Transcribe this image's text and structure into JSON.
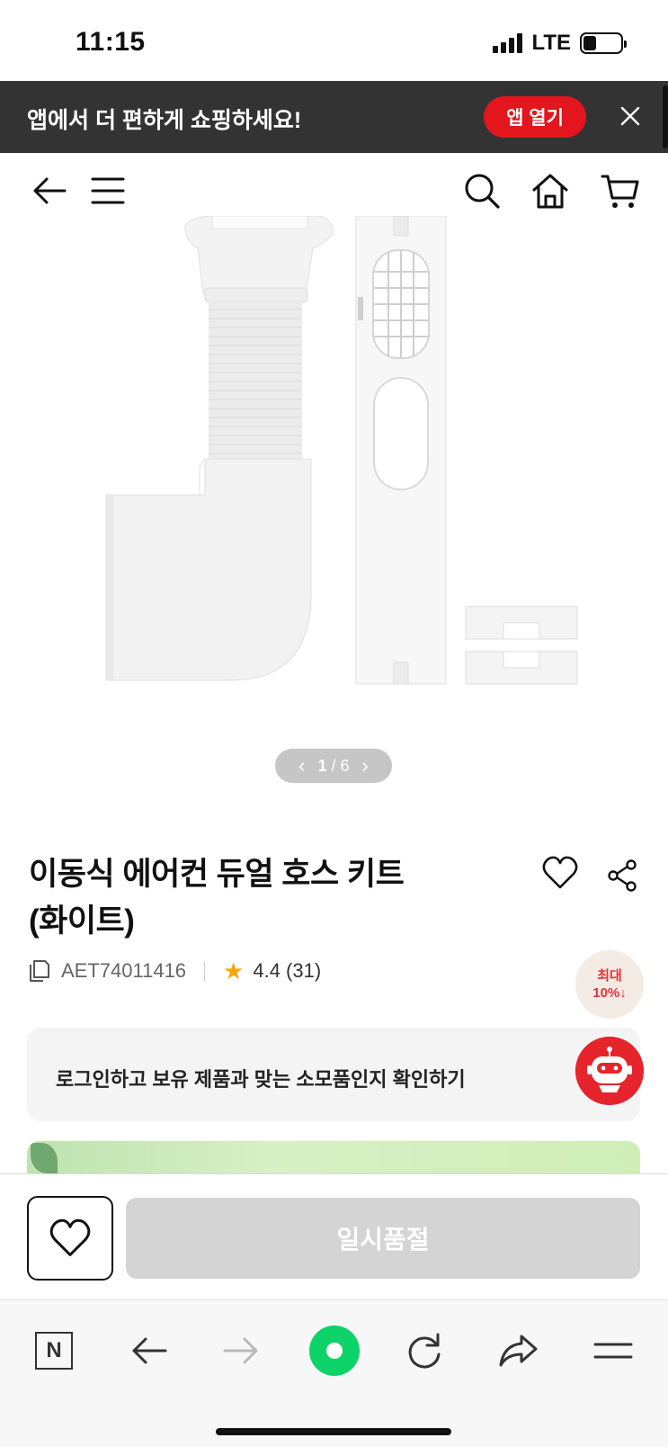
{
  "status_bar": {
    "time": "11:15",
    "network": "LTE"
  },
  "app_banner": {
    "message": "앱에서 더 편하게 쇼핑하세요!",
    "open_button": "앱 열기",
    "close_icon": "close-icon",
    "accent_color": "#e3161d"
  },
  "nav": {
    "icons": [
      "back-arrow-icon",
      "menu-icon",
      "search-icon",
      "home-icon",
      "cart-icon"
    ]
  },
  "gallery": {
    "current": "1",
    "separator": "/",
    "total": "6"
  },
  "product": {
    "title_line1": "이동식 에어컨 듀얼 호스 키트",
    "title_line2": "(화이트)",
    "model": "AET74011416",
    "rating": "4.4 (31)",
    "max_badge_line1": "최대",
    "max_badge_line2": "10%↓",
    "badge_color": "#e3333a"
  },
  "login_prompt": {
    "text": "로그인하고 보유 제품과 맞는 소모품인지 확인하기"
  },
  "actions": {
    "soldout_label": "일시품절"
  },
  "browser_toolbar": {
    "icons": [
      "naver-n-icon",
      "back-icon",
      "forward-icon",
      "green-dot-icon",
      "reload-icon",
      "share-icon",
      "menu-icon"
    ],
    "n_label": "N"
  }
}
